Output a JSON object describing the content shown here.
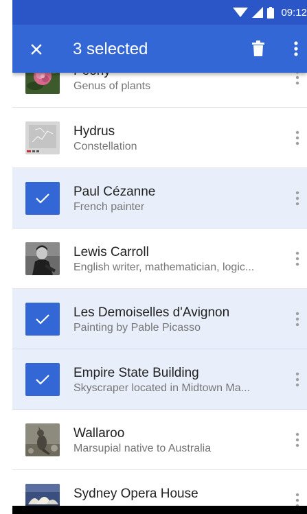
{
  "status_bar": {
    "time": "09:12"
  },
  "app_bar": {
    "title": "3 selected"
  },
  "items": [
    {
      "title": "Peony",
      "subtitle": "Genus of plants",
      "selected": false,
      "thumb": "peony"
    },
    {
      "title": "Hydrus",
      "subtitle": "Constellation",
      "selected": false,
      "thumb": "hydrus"
    },
    {
      "title": "Paul Cézanne",
      "subtitle": "French painter",
      "selected": true,
      "thumb": "check"
    },
    {
      "title": "Lewis Carroll",
      "subtitle": "English writer, mathematician, logic...",
      "selected": false,
      "thumb": "carroll"
    },
    {
      "title": "Les Demoiselles d'Avignon",
      "subtitle": "Painting by Pable Picasso",
      "selected": true,
      "thumb": "check"
    },
    {
      "title": "Empire State Building",
      "subtitle": "Skyscraper located in Midtown Ma...",
      "selected": true,
      "thumb": "check"
    },
    {
      "title": "Wallaroo",
      "subtitle": "Marsupial native to Australia",
      "selected": false,
      "thumb": "wallaroo"
    },
    {
      "title": "Sydney Opera House",
      "subtitle": "",
      "selected": false,
      "thumb": "opera"
    }
  ],
  "colors": {
    "status_bar": "#2a56c8",
    "app_bar": "#3367d6",
    "selected_row": "#e9effa",
    "checkbox": "#3367d6"
  },
  "icons": {
    "close": "close-icon",
    "delete": "delete-icon",
    "more": "more-vert-icon",
    "check": "check-icon"
  }
}
